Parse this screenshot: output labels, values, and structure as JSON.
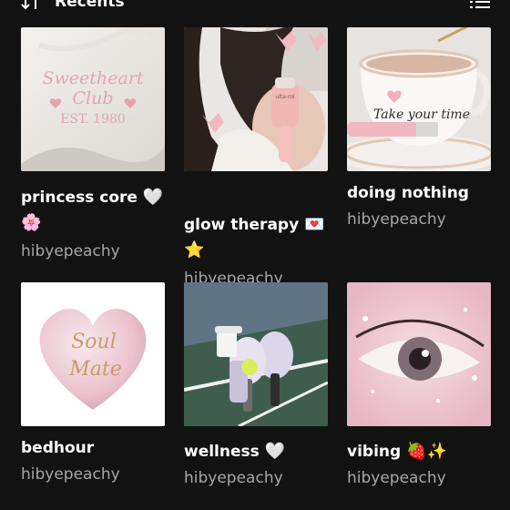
{
  "header": {
    "sort_label": "Recents",
    "sort_icon": "sort-arrows-icon",
    "view_icon": "list-view-icon"
  },
  "playlists": [
    {
      "title": "princess core",
      "emoji1": "🤍",
      "emoji2": "🌸",
      "owner": "hibyepeachy",
      "art_text": [
        "Sweetheart",
        "Club",
        "EST. 1980"
      ]
    },
    {
      "title": "glow therapy",
      "emoji1": "💌",
      "emoji2": "⭐",
      "owner": "hibyepeachy",
      "art_text": [
        "ulta-rol"
      ]
    },
    {
      "title": "doing nothing",
      "emoji1": "",
      "emoji2": "",
      "owner": "hibyepeachy",
      "art_text": [
        "Take your time"
      ]
    },
    {
      "title": "bedhour",
      "emoji1": "",
      "emoji2": "",
      "owner": "hibyepeachy",
      "art_text": [
        "Soul",
        "Mate"
      ]
    },
    {
      "title": "wellness",
      "emoji1": "🤍",
      "emoji2": "",
      "owner": "hibyepeachy",
      "art_text": []
    },
    {
      "title": "vibing",
      "emoji1": "🍓✨",
      "emoji2": "",
      "owner": "hibyepeachy",
      "art_text": []
    }
  ]
}
